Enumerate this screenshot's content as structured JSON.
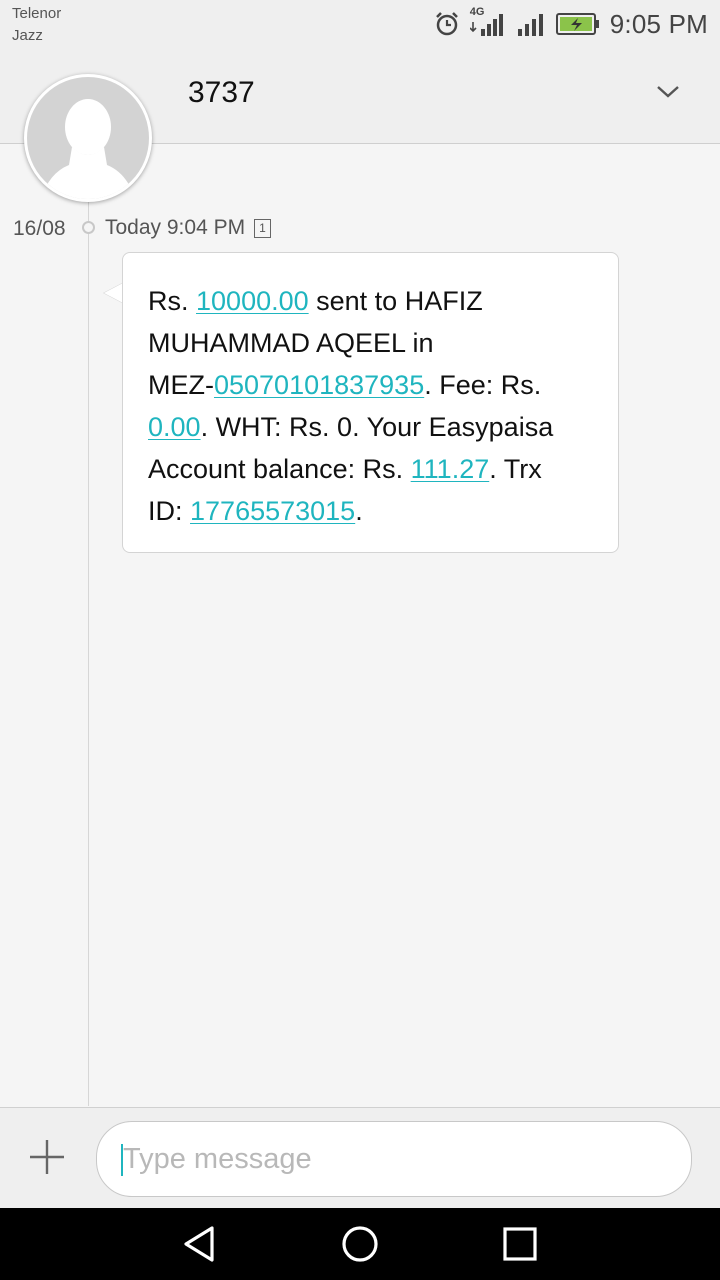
{
  "status_bar": {
    "carrier_1": "Telenor",
    "carrier_2": "Jazz",
    "network": "4G",
    "time": "9:05 PM",
    "icons": [
      "alarm-icon",
      "signal-4g-icon",
      "signal-icon",
      "battery-charging-icon"
    ],
    "battery_color": "#8bc34a"
  },
  "header": {
    "contact": "3737",
    "icons": [
      "avatar",
      "chevron-down-icon"
    ]
  },
  "thread": {
    "date": "16/08",
    "timestamp": "Today 9:04 PM",
    "sim_badge": "1",
    "message": {
      "p1": "Rs. ",
      "amount": "10000.00",
      "p2": " sent to HAFIZ",
      "p3": "MUHAMMAD AQEEL in",
      "p4": "MEZ-",
      "account": "05070101837935",
      "p5": ". Fee: Rs.",
      "fee": "0.00",
      "p6": ". WHT: Rs. 0. Your Easypaisa",
      "p7": "Account balance: Rs. ",
      "balance": "111.27",
      "p8": ". Trx",
      "p9": "ID: ",
      "trx_id": "17765573015",
      "p10": "."
    },
    "link_color": "#1fb5bf"
  },
  "compose": {
    "placeholder": "Type message",
    "icons": [
      "add-icon"
    ]
  },
  "nav_bar": {
    "icons": [
      "back-icon",
      "home-icon",
      "recents-icon"
    ]
  }
}
